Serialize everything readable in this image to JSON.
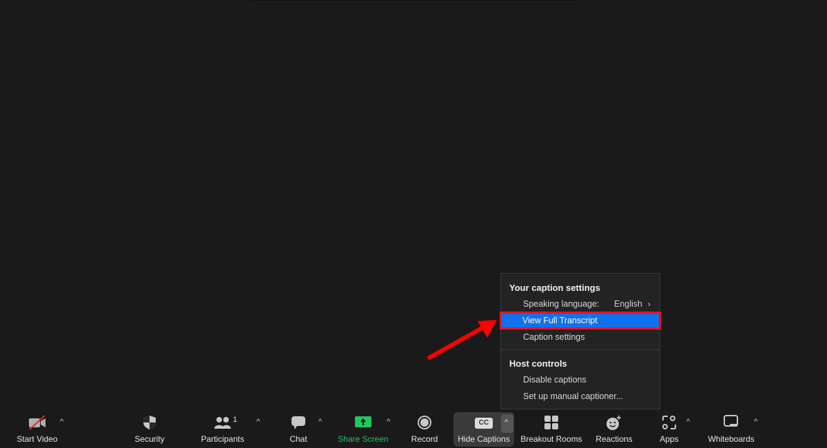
{
  "caption_menu": {
    "section1_title": "Your caption settings",
    "speaking_language_label": "Speaking language:",
    "speaking_language_value": "English",
    "view_full_transcript": "View Full Transcript",
    "caption_settings": "Caption settings",
    "section2_title": "Host controls",
    "disable_captions": "Disable captions",
    "setup_manual_captioner": "Set up manual captioner..."
  },
  "annotation": {
    "highlight_color": "#e8102a",
    "arrow_color": "#ff0000"
  },
  "toolbar": {
    "start_video": "Start Video",
    "security": "Security",
    "participants": "Participants",
    "participants_count": "1",
    "chat": "Chat",
    "share_screen": "Share Screen",
    "record": "Record",
    "hide_captions": "Hide Captions",
    "cc_badge": "CC",
    "breakout_rooms": "Breakout Rooms",
    "reactions": "Reactions",
    "apps": "Apps",
    "whiteboards": "Whiteboards",
    "share_color": "#22c55e",
    "caret": "^"
  }
}
